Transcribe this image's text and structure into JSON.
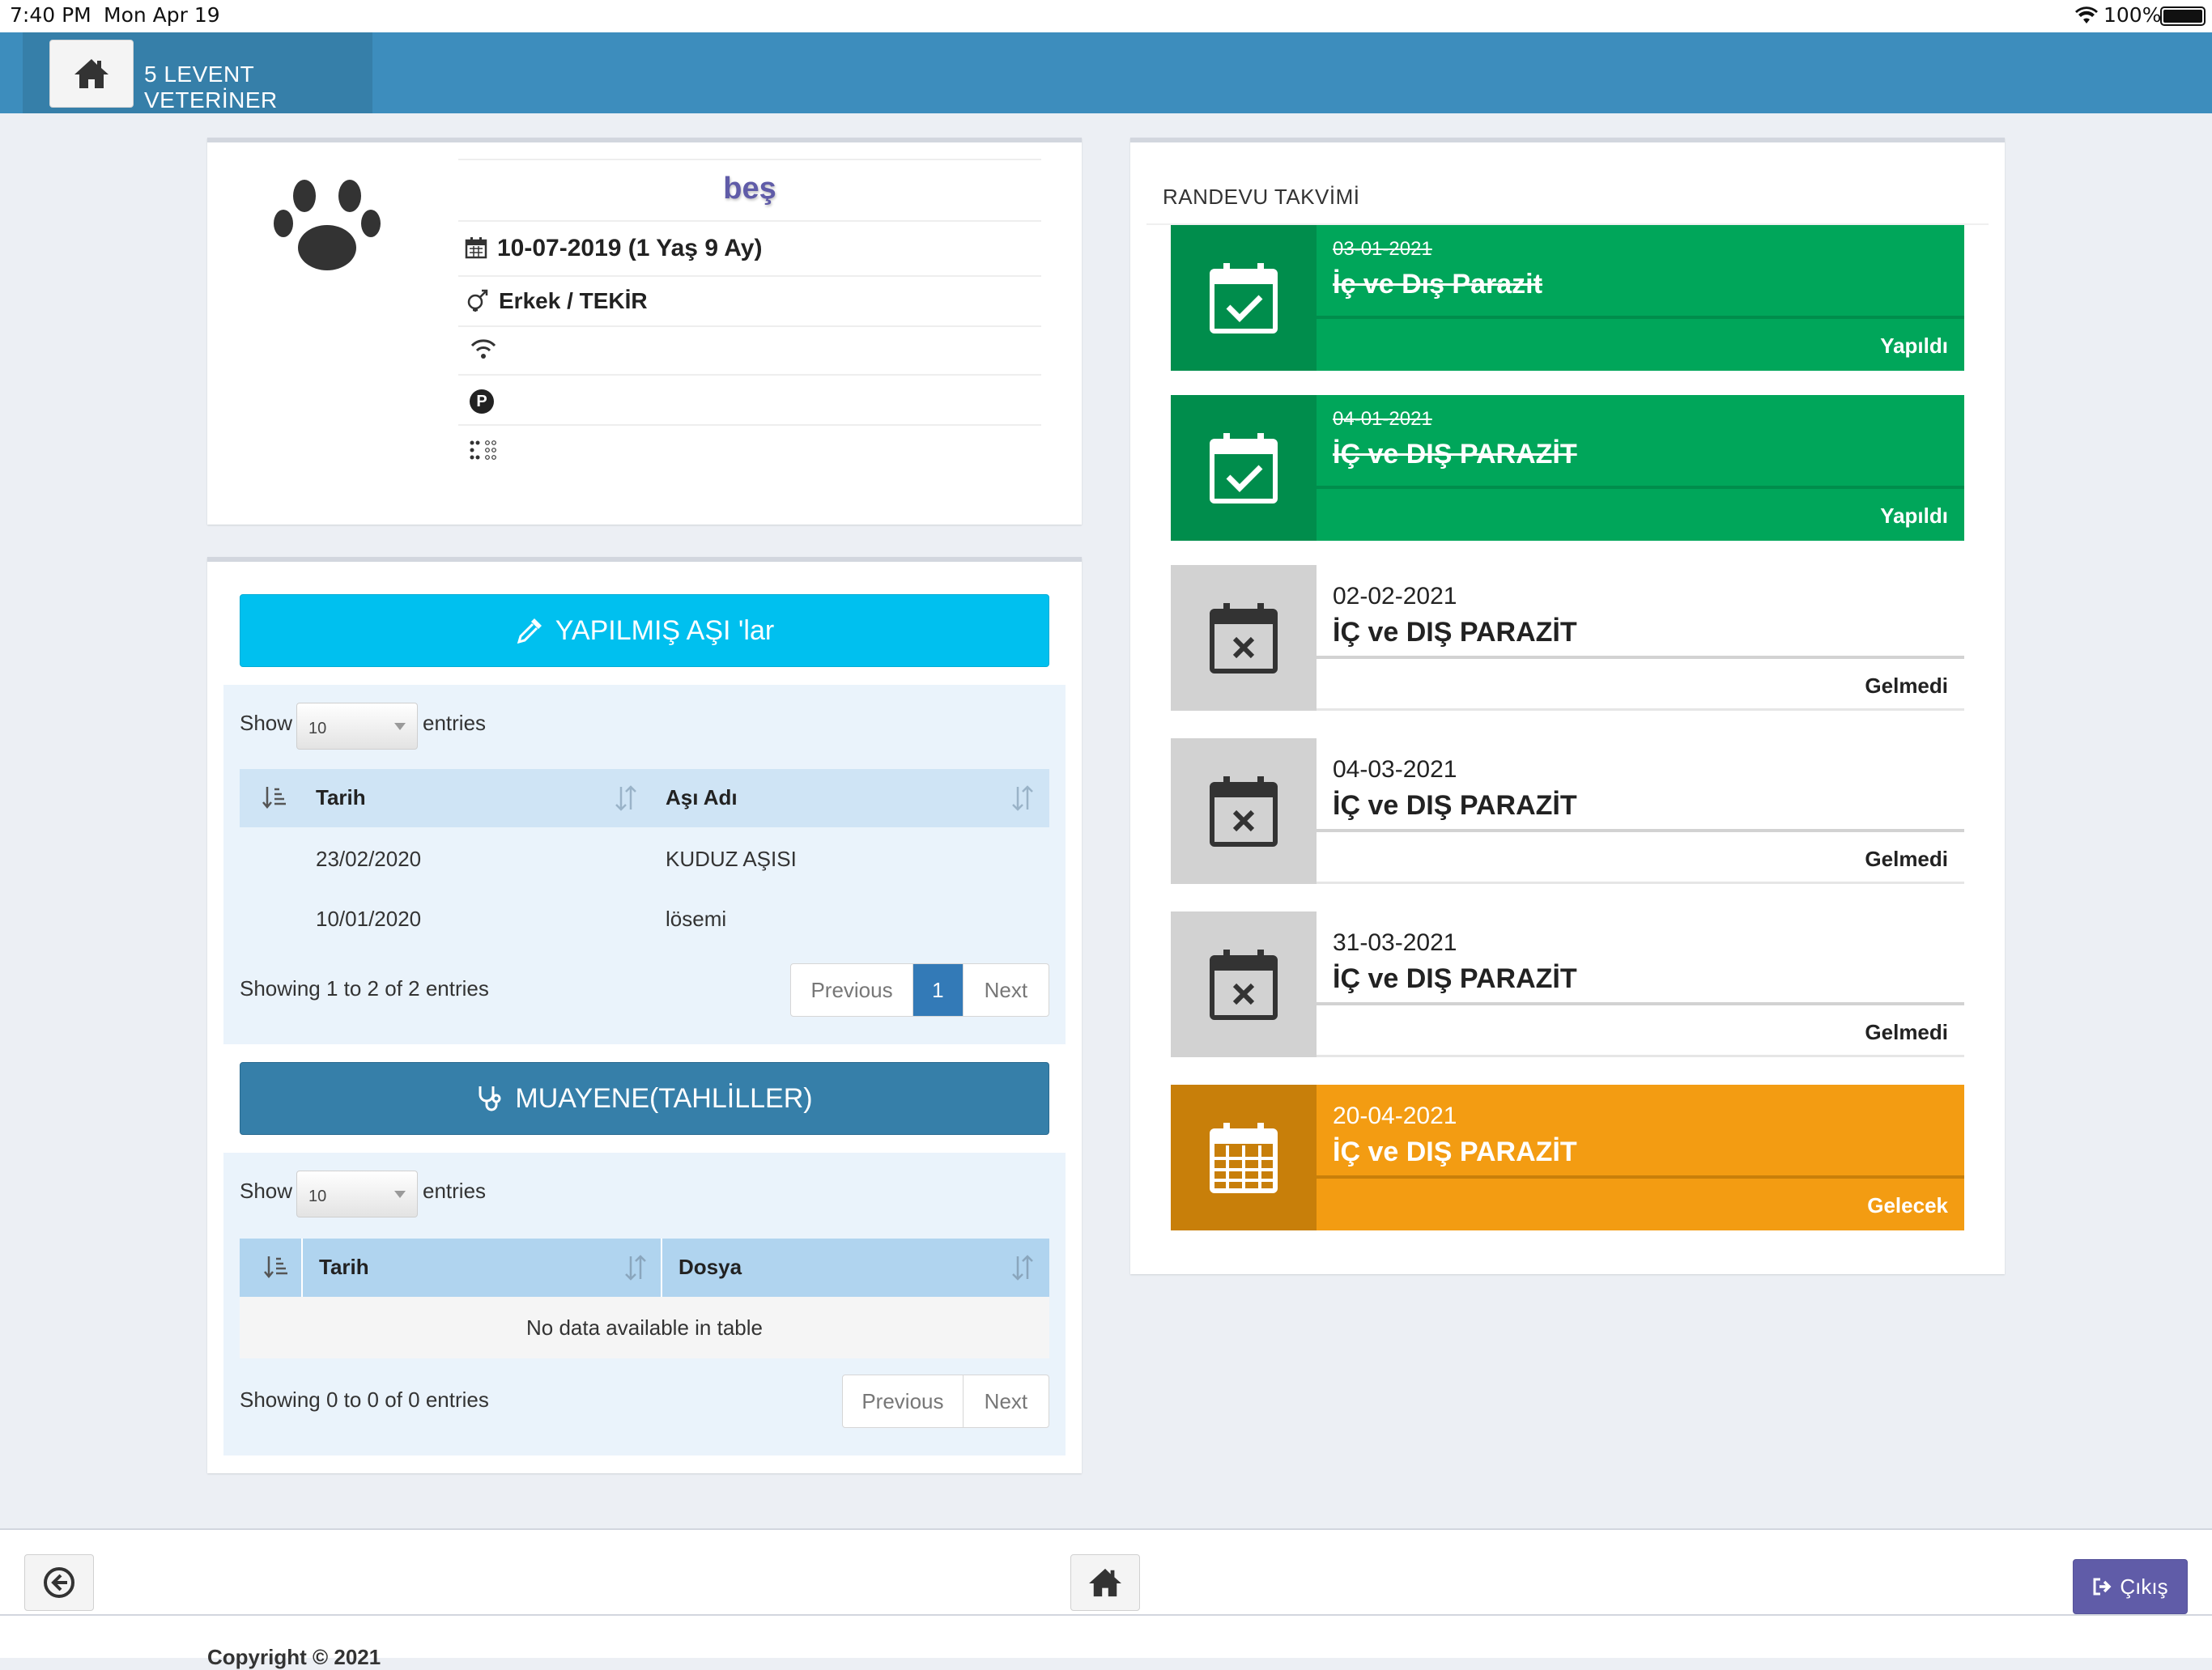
{
  "status_bar": {
    "time": "7:40 PM",
    "date": "Mon Apr 19",
    "battery": "100%"
  },
  "header": {
    "brand": "5 LEVENT VETERİNER",
    "home_icon": "home-icon"
  },
  "pet": {
    "name": "beş",
    "birth": "10-07-2019 (1 Yaş 9 Ay)",
    "gender_breed": "Erkek / TEKİR",
    "chip": "",
    "passport": "",
    "code": ""
  },
  "vaccines": {
    "button_label": "YAPILMIŞ AŞI 'lar",
    "show_label": "Show",
    "entries_label": "entries",
    "page_size": "10",
    "columns": [
      "Tarih",
      "Aşı Adı"
    ],
    "rows": [
      {
        "date": "23/02/2020",
        "name": "KUDUZ AŞISI"
      },
      {
        "date": "10/01/2020",
        "name": "lösemi"
      }
    ],
    "info": "Showing 1 to 2 of 2 entries",
    "prev": "Previous",
    "page": "1",
    "next": "Next"
  },
  "exams": {
    "button_label": "MUAYENE(TAHLİLLER)",
    "show_label": "Show",
    "entries_label": "entries",
    "page_size": "10",
    "columns": [
      "Tarih",
      "Dosya"
    ],
    "empty": "No data available in table",
    "info": "Showing 0 to 0 of 0 entries",
    "prev": "Previous",
    "next": "Next"
  },
  "calendar": {
    "title": "RANDEVU TAKVİMİ",
    "events": [
      {
        "date": "03-01-2021",
        "title": "İç ve Dış Parazit",
        "status": "Yapıldı"
      },
      {
        "date": "04-01-2021",
        "title": "İÇ ve DIŞ PARAZİT",
        "status": "Yapıldı"
      },
      {
        "date": "02-02-2021",
        "title": "İÇ ve DIŞ PARAZİT",
        "status": "Gelmedi"
      },
      {
        "date": "04-03-2021",
        "title": "İÇ ve DIŞ PARAZİT",
        "status": "Gelmedi"
      },
      {
        "date": "31-03-2021",
        "title": "İÇ ve DIŞ PARAZİT",
        "status": "Gelmedi"
      },
      {
        "date": "20-04-2021",
        "title": "İÇ ve DIŞ PARAZİT",
        "status": "Gelecek"
      }
    ]
  },
  "footer": {
    "logout": "Çıkış",
    "copyright": "Copyright © 2021"
  },
  "colors": {
    "header": "#3d8dbd",
    "done": "#00a65a",
    "future": "#f39c12",
    "missed": "#d2d2d2",
    "vaccine_button": "#00c0ef",
    "exam_button": "#367fa9",
    "logout_button": "#605ca8"
  }
}
